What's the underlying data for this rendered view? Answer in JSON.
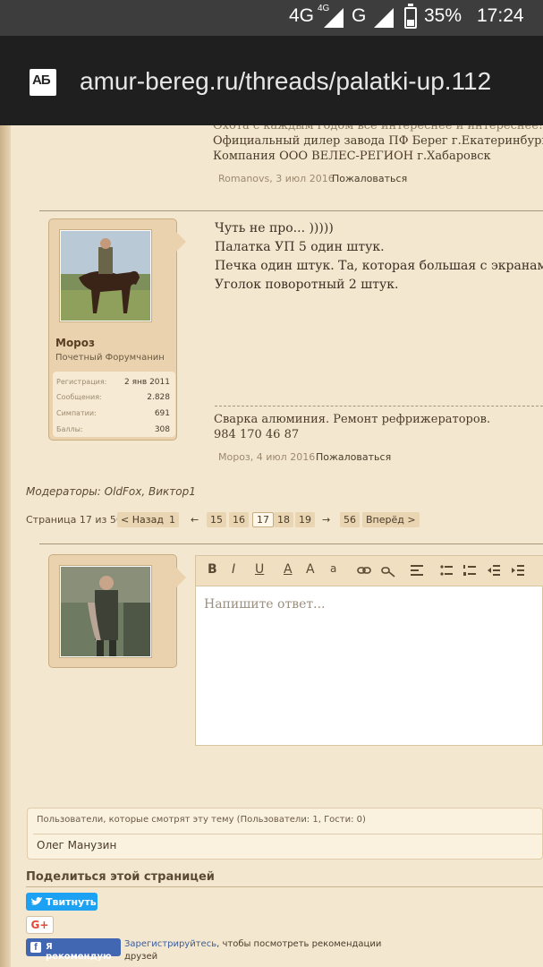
{
  "status_bar": {
    "network": "4G",
    "network_sup": "4G",
    "network2": "G",
    "battery": "35%",
    "time": "17:24"
  },
  "browser": {
    "site_icon_text": "АБ",
    "url": "amur-bereg.ru/threads/palatki-up.112"
  },
  "prev_post": {
    "signature": [
      "Охота с каждым годом все интереснее и интереснее!!!, а ло",
      "Официальный дилер завода ПФ Берег г.Екатеринбург. http:/",
      "Компания ООО ВЕЛЕС-РЕГИОН г.Хабаровск"
    ],
    "author": "Romanovs",
    "date": "3 июл 2016",
    "report": "Пожаловаться"
  },
  "post": {
    "username": "Мороз",
    "user_title": "Почетный Форумчанин",
    "stats": [
      {
        "label": "Регистрация:",
        "value": "2 янв 2011"
      },
      {
        "label": "Сообщения:",
        "value": "2.828"
      },
      {
        "label": "Симпатии:",
        "value": "691"
      },
      {
        "label": "Баллы:",
        "value": "308"
      }
    ],
    "lines": [
      "Чуть не про... )))))",
      "Палатка УП 5 один штук.",
      "Печка один штук. Та, которая большая с экранам",
      "Уголок поворотный 2 штук."
    ],
    "signature": [
      "Сварка алюминия. Ремонт рефрижераторов.",
      "984 170 46 87"
    ],
    "author_date": "Мороз, 4 июл 2016",
    "report": "Пожаловаться"
  },
  "moderators": "Модераторы: OldFox, Виктор1",
  "pagination": {
    "label": "Страница 17 из 56",
    "prev": "< Назад",
    "next": "Вперёд >",
    "first": "1",
    "arrow_left": "←",
    "p15": "15",
    "p16": "16",
    "current": "17",
    "p18": "18",
    "p19": "19",
    "arrow_right": "→",
    "last": "56"
  },
  "editor": {
    "placeholder": "Напишите ответ...",
    "tools": [
      "B",
      "I",
      "U",
      "A",
      "A",
      "a"
    ]
  },
  "watching": {
    "title": "Пользователи, которые смотрят эту тему (Пользователи: 1, Гости: 0)",
    "user": "Олег Манузин"
  },
  "share": {
    "title": "Поделиться этой страницей",
    "tweet": "Твитнуть",
    "gplus": "G+",
    "fb_recommend": "Я рекомендую",
    "fb_register": "Зарегистрируйтесь",
    "fb_text": ", чтобы посмотреть рекомендации друзей"
  }
}
